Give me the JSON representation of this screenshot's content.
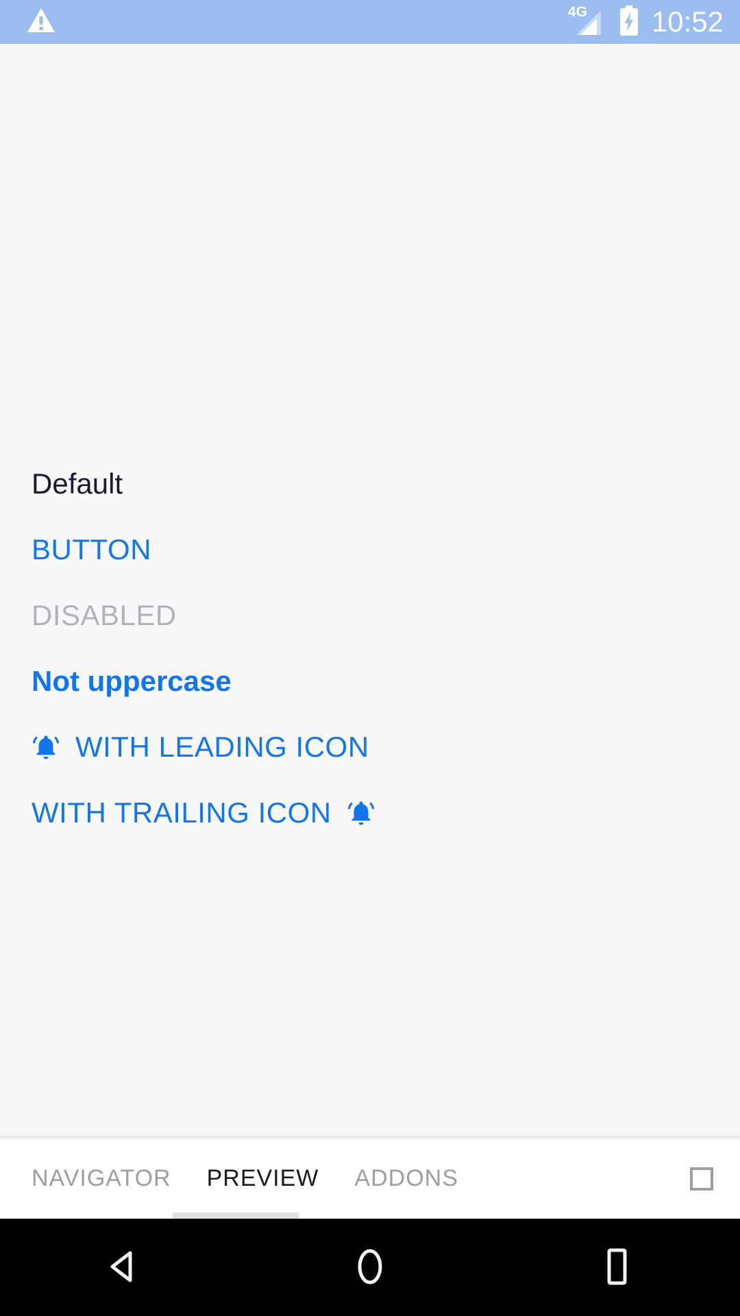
{
  "status_bar": {
    "warning_icon": "warning-triangle-icon",
    "network_type": "4G",
    "signal_icon": "signal-bars-icon",
    "battery_icon": "battery-charging-icon",
    "clock": "10:52",
    "background_color": "#9bbdf0",
    "foreground_color": "#ffffff"
  },
  "content": {
    "background_color": "#f8f8f9",
    "accent_color": "#1176ee",
    "disabled_color": "#b2b2bf",
    "default_text_color": "#191933",
    "rows": [
      {
        "kind": "label",
        "label": "Default",
        "icon": null,
        "icon_position": null
      },
      {
        "kind": "button",
        "label": "BUTTON",
        "icon": null,
        "icon_position": null
      },
      {
        "kind": "button",
        "label": "DISABLED",
        "icon": null,
        "icon_position": null
      },
      {
        "kind": "button",
        "label": "Not uppercase",
        "icon": null,
        "icon_position": null
      },
      {
        "kind": "button",
        "label": "WITH LEADING ICON",
        "icon": "notification-bell-active-icon",
        "icon_position": "leading"
      },
      {
        "kind": "button",
        "label": "WITH TRAILING ICON",
        "icon": "notification-bell-active-icon",
        "icon_position": "trailing"
      }
    ]
  },
  "tab_bar": {
    "tabs": [
      {
        "label": "NAVIGATOR",
        "active": false
      },
      {
        "label": "PREVIEW",
        "active": true
      },
      {
        "label": "ADDONS",
        "active": false
      }
    ],
    "right_action_icon": "square-outline-icon",
    "active_color": "#1a1a1a",
    "inactive_color": "#9e9e9e",
    "indicator_color": "#e0e0e0"
  },
  "nav_bar": {
    "background_color": "#000000",
    "buttons": [
      {
        "icon": "back-triangle-icon"
      },
      {
        "icon": "home-circle-icon"
      },
      {
        "icon": "recents-square-icon"
      }
    ]
  }
}
